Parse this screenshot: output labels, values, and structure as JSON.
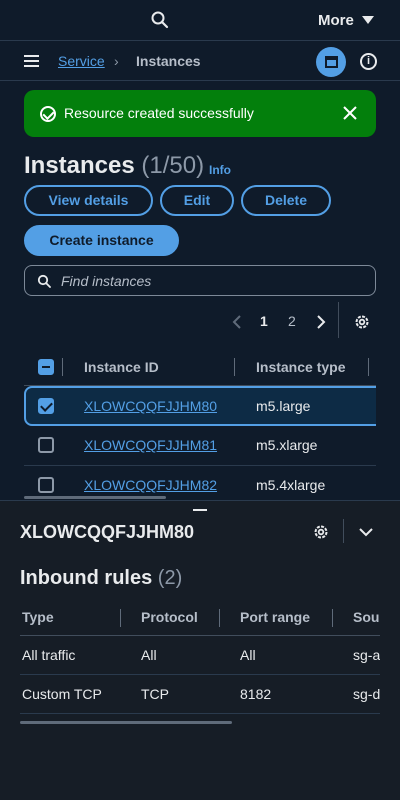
{
  "topbar": {
    "more_label": "More"
  },
  "breadcrumb": {
    "service": "Service",
    "separator": "›",
    "current": "Instances"
  },
  "flash": {
    "message": "Resource created successfully"
  },
  "header": {
    "title": "Instances",
    "count": "(1/50)",
    "info": "Info"
  },
  "actions": {
    "view_details": "View details",
    "edit": "Edit",
    "delete": "Delete",
    "create": "Create instance"
  },
  "search": {
    "placeholder": "Find instances"
  },
  "pagination": {
    "page1": "1",
    "page2": "2"
  },
  "table": {
    "columns": [
      "Instance ID",
      "Instance type"
    ],
    "rows": [
      {
        "id": "XLOWCQQFJJHM80",
        "type": "m5.large",
        "selected": true
      },
      {
        "id": "XLOWCQQFJJHM81",
        "type": "m5.xlarge",
        "selected": false
      },
      {
        "id": "XLOWCQQFJJHM82",
        "type": "m5.4xlarge",
        "selected": false
      }
    ]
  },
  "panel": {
    "title": "XLOWCQQFJJHM80",
    "section_title": "Inbound rules",
    "section_count": "(2)",
    "columns": [
      "Type",
      "Protocol",
      "Port range",
      "Sou"
    ],
    "rows": [
      [
        "All traffic",
        "All",
        "All",
        "sg-a"
      ],
      [
        "Custom TCP",
        "TCP",
        "8182",
        "sg-d"
      ]
    ]
  },
  "colors": {
    "accent": "#539fe5",
    "success": "#037f0c",
    "background": "#0f1b2a"
  },
  "icons": [
    "search-icon",
    "chevron-down-icon",
    "menu-icon",
    "split-panel-icon",
    "info-icon",
    "check-circle-icon",
    "close-icon",
    "chevron-left-icon",
    "chevron-right-icon",
    "gear-icon"
  ]
}
